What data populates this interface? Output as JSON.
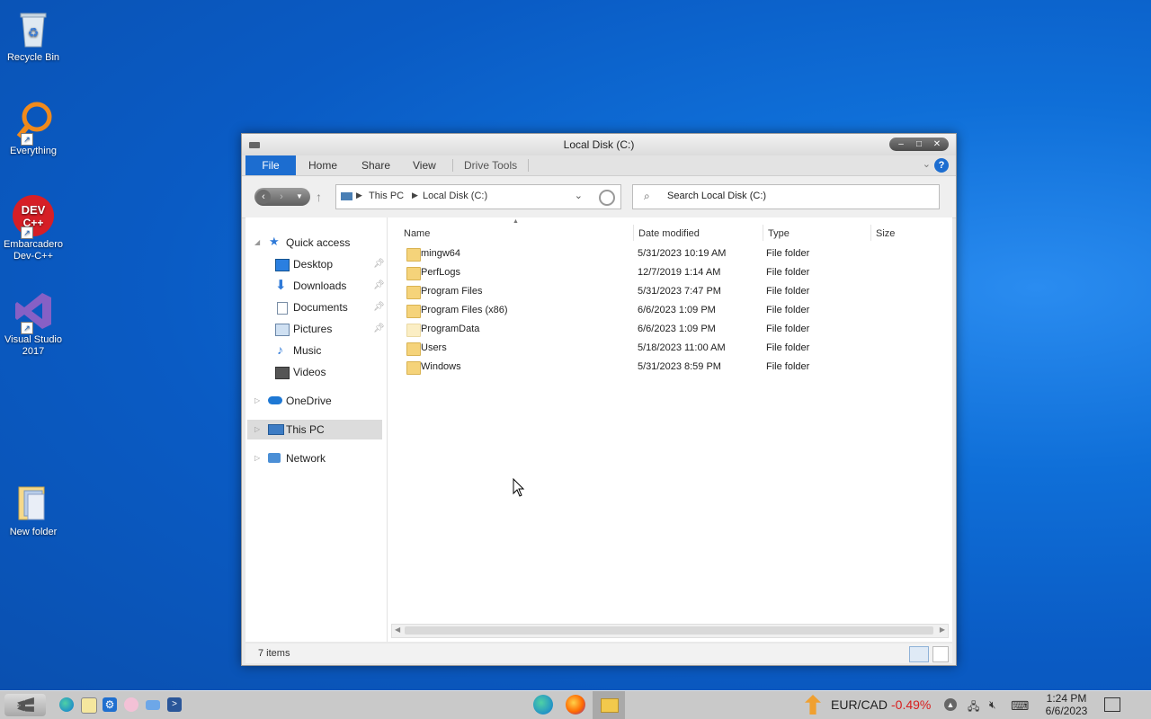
{
  "desktop": {
    "icons": [
      {
        "label": "Recycle Bin"
      },
      {
        "label": "Everything"
      },
      {
        "label": "Embarcadero Dev-C++"
      },
      {
        "label": "Visual Studio 2017"
      },
      {
        "label": "New folder"
      }
    ]
  },
  "window": {
    "title": "Local Disk (C:)",
    "controls": {
      "minimize": "–",
      "maximize": "□",
      "close": "✕"
    },
    "ribbon": {
      "tabs": [
        "File",
        "Home",
        "Share",
        "View",
        "Drive Tools"
      ],
      "help": "?"
    },
    "address": {
      "crumbs": [
        "This PC",
        "Local Disk (C:)"
      ]
    },
    "search": {
      "placeholder": "Search Local Disk (C:)"
    },
    "sidebar": {
      "items": [
        {
          "label": "Quick access",
          "icon": "star-icon"
        },
        {
          "label": "Desktop",
          "icon": "desktop-icon",
          "pinned": true
        },
        {
          "label": "Downloads",
          "icon": "download-icon",
          "pinned": true
        },
        {
          "label": "Documents",
          "icon": "document-icon",
          "pinned": true
        },
        {
          "label": "Pictures",
          "icon": "pictures-icon",
          "pinned": true
        },
        {
          "label": "Music",
          "icon": "music-icon"
        },
        {
          "label": "Videos",
          "icon": "video-icon"
        },
        {
          "label": "OneDrive",
          "icon": "cloud-icon"
        },
        {
          "label": "This PC",
          "icon": "computer-icon",
          "selected": true
        },
        {
          "label": "Network",
          "icon": "network-icon"
        }
      ]
    },
    "columns": [
      "Name",
      "Date modified",
      "Type",
      "Size"
    ],
    "files": [
      {
        "name": "mingw64",
        "date": "5/31/2023 10:19 AM",
        "type": "File folder"
      },
      {
        "name": "PerfLogs",
        "date": "12/7/2019 1:14 AM",
        "type": "File folder"
      },
      {
        "name": "Program Files",
        "date": "5/31/2023 7:47 PM",
        "type": "File folder"
      },
      {
        "name": "Program Files (x86)",
        "date": "6/6/2023 1:09 PM",
        "type": "File folder"
      },
      {
        "name": "ProgramData",
        "date": "6/6/2023 1:09 PM",
        "type": "File folder",
        "hidden": true
      },
      {
        "name": "Users",
        "date": "5/18/2023 11:00 AM",
        "type": "File folder"
      },
      {
        "name": "Windows",
        "date": "5/31/2023 8:59 PM",
        "type": "File folder"
      }
    ],
    "status": {
      "item_count": "7 items"
    }
  },
  "taskbar": {
    "ticker": {
      "pair": "EUR/CAD",
      "change": "-0.49%"
    },
    "clock": {
      "time": "1:24 PM",
      "date": "6/6/2023"
    }
  }
}
